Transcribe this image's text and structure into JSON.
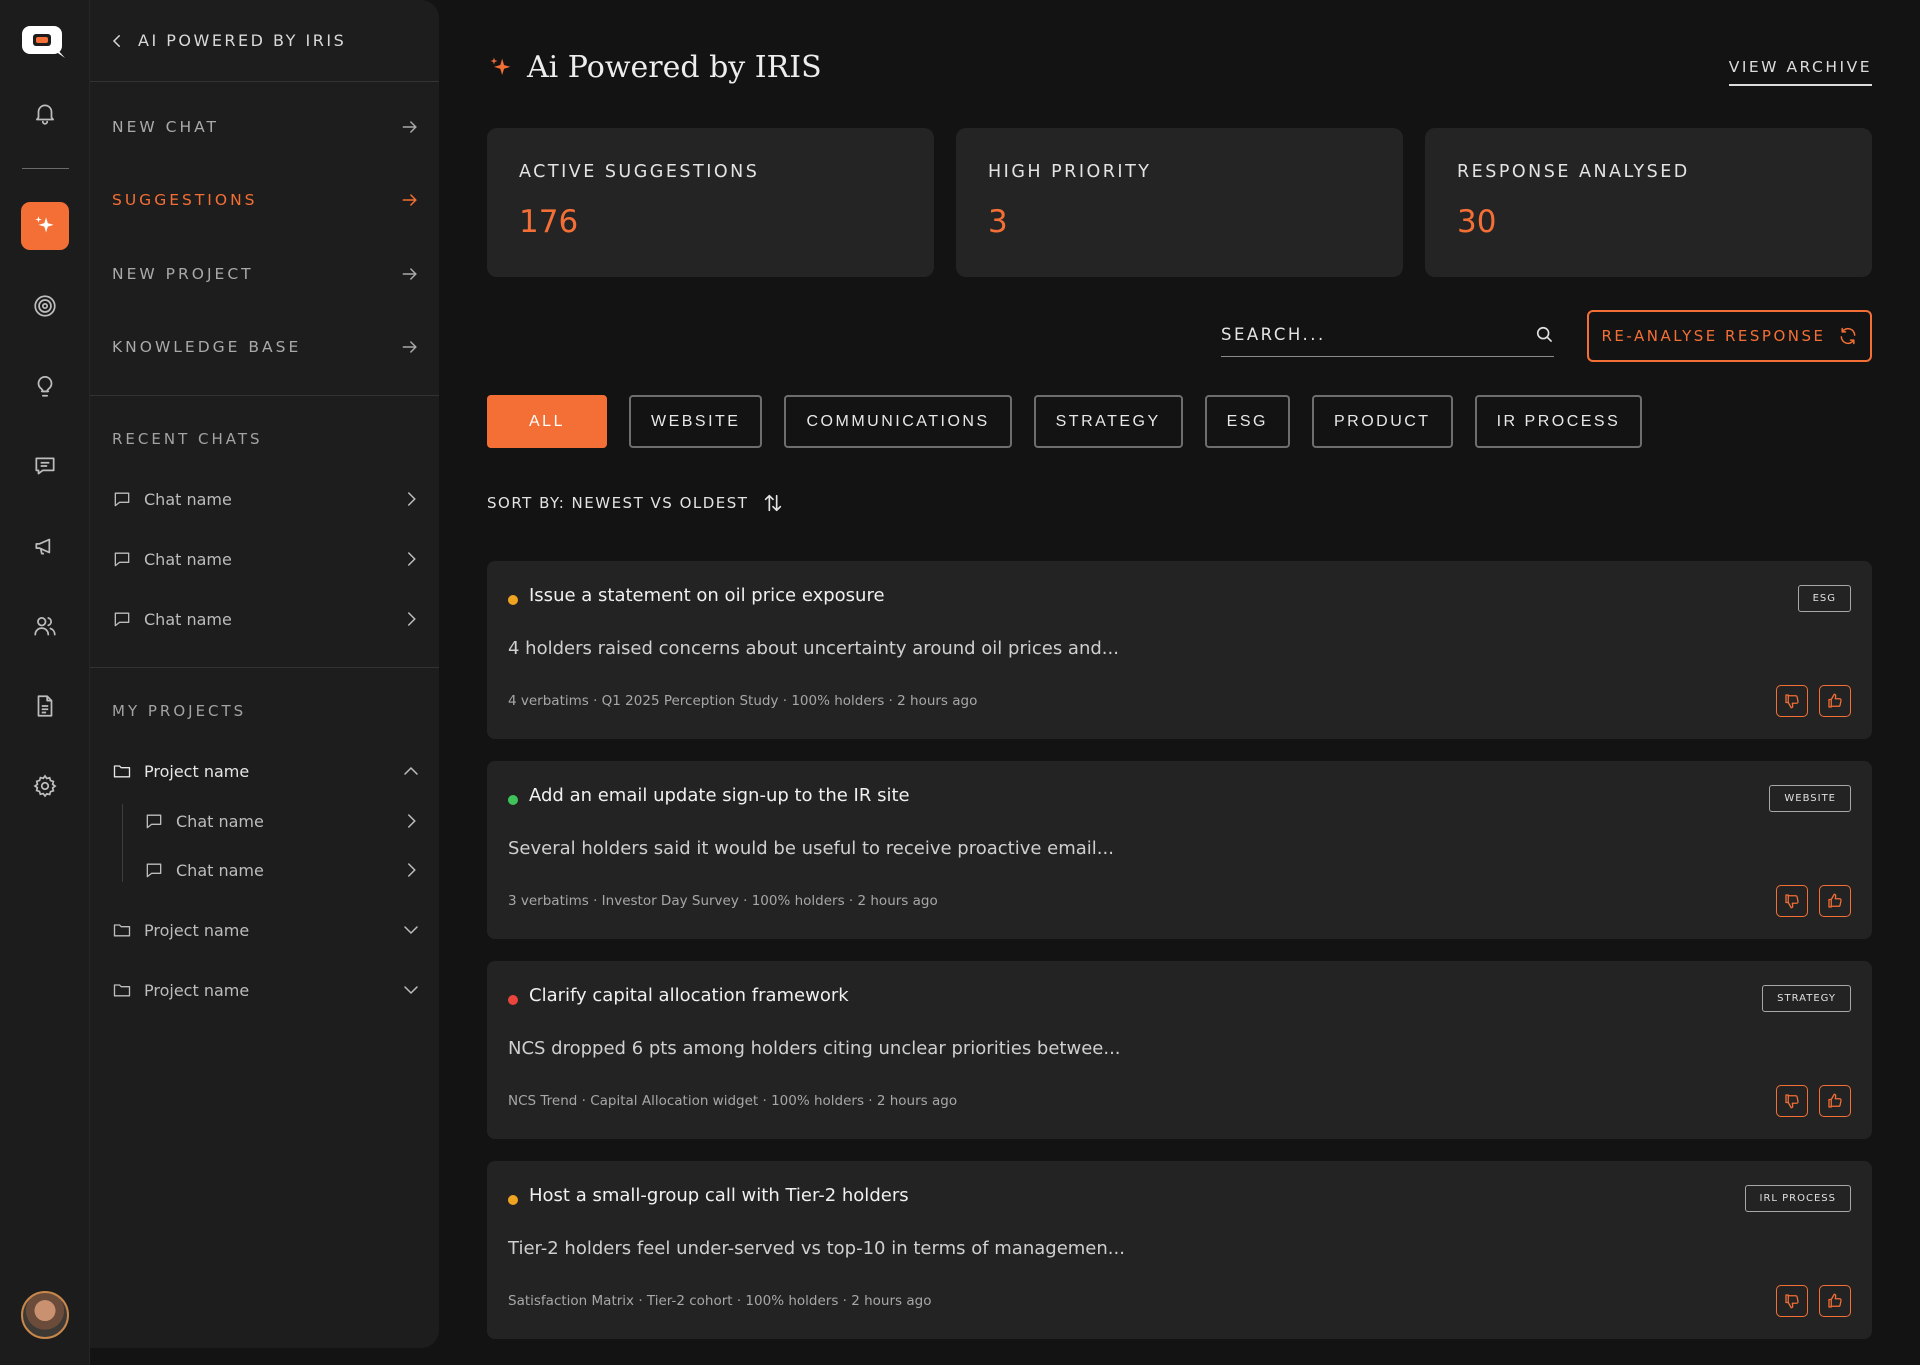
{
  "sidebar": {
    "header": "AI POWERED BY IRIS",
    "nav": [
      {
        "label": "NEW CHAT"
      },
      {
        "label": "SUGGESTIONS"
      },
      {
        "label": "NEW PROJECT"
      },
      {
        "label": "KNOWLEDGE BASE"
      }
    ],
    "recent_title": "RECENT CHATS",
    "recent_chats": [
      "Chat name",
      "Chat name",
      "Chat name"
    ],
    "projects_title": "MY PROJECTS",
    "projects": [
      {
        "name": "Project name",
        "chats": [
          "Chat name",
          "Chat name"
        ]
      },
      {
        "name": "Project name"
      },
      {
        "name": "Project name"
      }
    ]
  },
  "rail": {
    "icons": [
      "logo-icon",
      "bell-icon",
      "sparkle-icon",
      "target-icon",
      "lightbulb-icon",
      "message-icon",
      "megaphone-icon",
      "users-icon",
      "document-icon",
      "gear-icon"
    ]
  },
  "header": {
    "title": "Ai Powered by IRIS",
    "view_archive": "VIEW ARCHIVE"
  },
  "stats": [
    {
      "label": "ACTIVE SUGGESTIONS",
      "value": "176"
    },
    {
      "label": "HIGH PRIORITY",
      "value": "3"
    },
    {
      "label": "RESPONSE ANALYSED",
      "value": "30"
    }
  ],
  "search": {
    "placeholder": "SEARCH..."
  },
  "reanalyse_label": "RE-ANALYSE RESPONSE",
  "filters": [
    "ALL",
    "WEBSITE",
    "COMMUNICATIONS",
    "STRATEGY",
    "ESG",
    "PRODUCT",
    "IR PROCESS"
  ],
  "sort_label": "SORT BY: NEWEST VS OLDEST",
  "cards": [
    {
      "title": "Issue a statement on oil price exposure",
      "tag": "ESG",
      "desc": "4 holders raised concerns about uncertainty around oil prices and...",
      "meta": "4 verbatims · Q1 2025 Perception Study · 100% holders · 2 hours ago",
      "dot": "#f0a321"
    },
    {
      "title": "Add an email update sign-up to the IR site",
      "tag": "WEBSITE",
      "desc": "Several holders said it would be useful to receive proactive email...",
      "meta": "3 verbatims · Investor Day Survey · 100% holders · 2 hours ago",
      "dot": "#3ec45a"
    },
    {
      "title": "Clarify capital allocation framework",
      "tag": "STRATEGY",
      "desc": "NCS dropped 6 pts among holders citing unclear priorities betwee...",
      "meta": "NCS Trend · Capital Allocation widget · 100% holders · 2 hours ago",
      "dot": "#e8453c"
    },
    {
      "title": "Host a small-group call with Tier-2 holders",
      "tag": "IRL PROCESS",
      "desc": "Tier-2 holders feel under-served vs top-10 in terms of managemen...",
      "meta": "Satisfaction Matrix · Tier-2 cohort · 100% holders · 2 hours ago",
      "dot": "#f0a321"
    }
  ],
  "colors": {
    "accent": "#f46f35",
    "background": "#131313",
    "card": "#232323"
  }
}
